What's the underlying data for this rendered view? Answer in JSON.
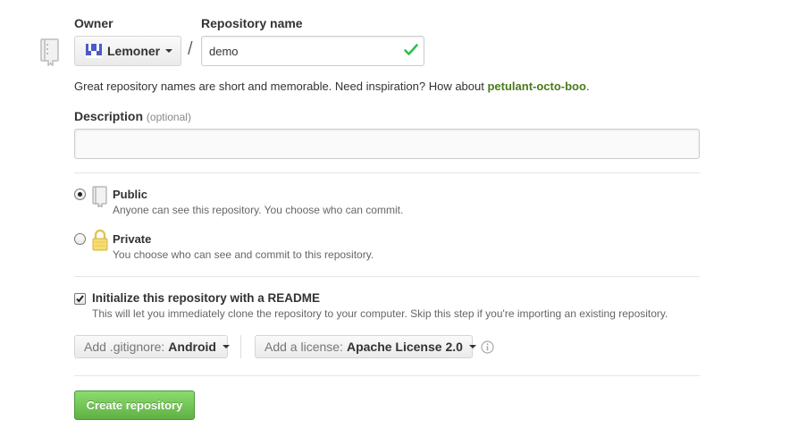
{
  "owner": {
    "label": "Owner",
    "selected": "Lemoner"
  },
  "repo_name": {
    "label": "Repository name",
    "value": "demo",
    "separator": "/"
  },
  "hint": {
    "text": "Great repository names are short and memorable. Need inspiration? How about ",
    "suggestion": "petulant-octo-boo",
    "suffix": "."
  },
  "description": {
    "label": "Description",
    "optional": "(optional)",
    "value": "",
    "placeholder": ""
  },
  "visibility": {
    "public": {
      "title": "Public",
      "desc": "Anyone can see this repository. You choose who can commit."
    },
    "private": {
      "title": "Private",
      "desc": "You choose who can see and commit to this repository."
    },
    "selected": "public"
  },
  "readme": {
    "checked": true,
    "title": "Initialize this repository with a README",
    "desc": "This will let you immediately clone the repository to your computer. Skip this step if you're importing an existing repository."
  },
  "gitignore": {
    "prefix": "Add .gitignore:",
    "value": "Android"
  },
  "license": {
    "prefix": "Add a license:",
    "value": "Apache License 2.0"
  },
  "submit": {
    "label": "Create repository"
  },
  "colors": {
    "accent_green": "#60b044",
    "suggestion_green": "#4a7a1b",
    "valid_check": "#2cbe4e",
    "owner_avatar": "#4a5bc7"
  }
}
